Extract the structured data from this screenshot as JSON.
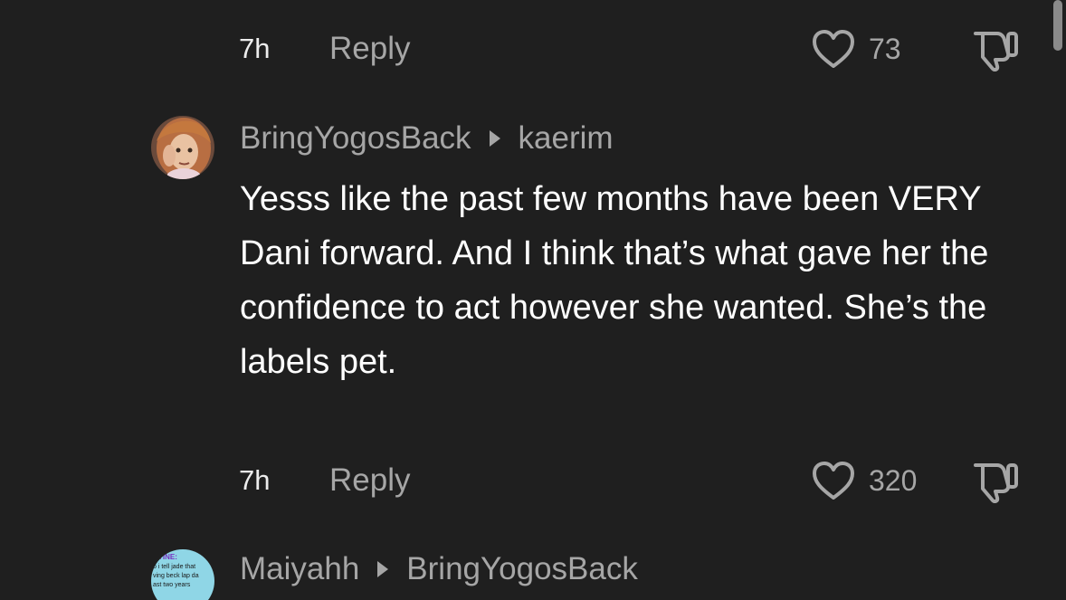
{
  "top_comment_footer": {
    "time": "7h",
    "reply_label": "Reply",
    "like_count": "73"
  },
  "comment": {
    "username": "BringYogosBack",
    "reply_to": "kaerim",
    "text": "Yesss like the past few months have been VERY Dani forward. And I think that’s what gave her the confidence to act however she wanted. She’s the labels pet.",
    "time": "7h",
    "reply_label": "Reply",
    "like_count": "320"
  },
  "next_comment": {
    "username": "Maiyahh",
    "reply_to": "BringYogosBack",
    "avatar_text": [
      "TINE:",
      "o i tell jade that",
      "ving beck lap da",
      "ast two years"
    ]
  },
  "colors": {
    "background": "#1f1f1f",
    "primary_text": "#ffffff",
    "secondary_text": "#a6a6a6"
  }
}
